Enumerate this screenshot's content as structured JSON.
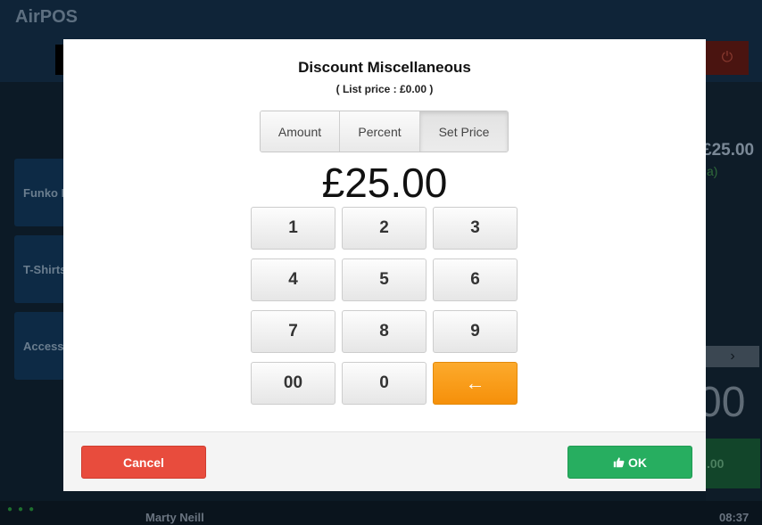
{
  "app": {
    "title": "AirPOS",
    "power_icon": "power-icon",
    "tiles": [
      {
        "label": "Funko Movie"
      },
      {
        "label": "T-Shirts"
      },
      {
        "label": "Accessories"
      }
    ],
    "right_price": "£25.00",
    "right_price_sub": "a)",
    "right_big": "00",
    "right_green_label": ".00",
    "footer": {
      "user": "Marty Neill",
      "time": "08:37"
    }
  },
  "modal": {
    "title": "Discount Miscellaneous",
    "subtitle": "( List price : £0.00 )",
    "tabs": [
      {
        "label": "Amount",
        "active": false
      },
      {
        "label": "Percent",
        "active": false
      },
      {
        "label": "Set Price",
        "active": true
      }
    ],
    "display_value": "£25.00",
    "keys": [
      "1",
      "2",
      "3",
      "4",
      "5",
      "6",
      "7",
      "8",
      "9",
      "00",
      "0",
      "←"
    ],
    "cancel_label": "Cancel",
    "ok_label": "OK",
    "ok_icon": "thumbs-up-icon"
  },
  "colors": {
    "cancel": "#e84c3d",
    "ok": "#27ae60",
    "backspace": "#f6900a"
  }
}
